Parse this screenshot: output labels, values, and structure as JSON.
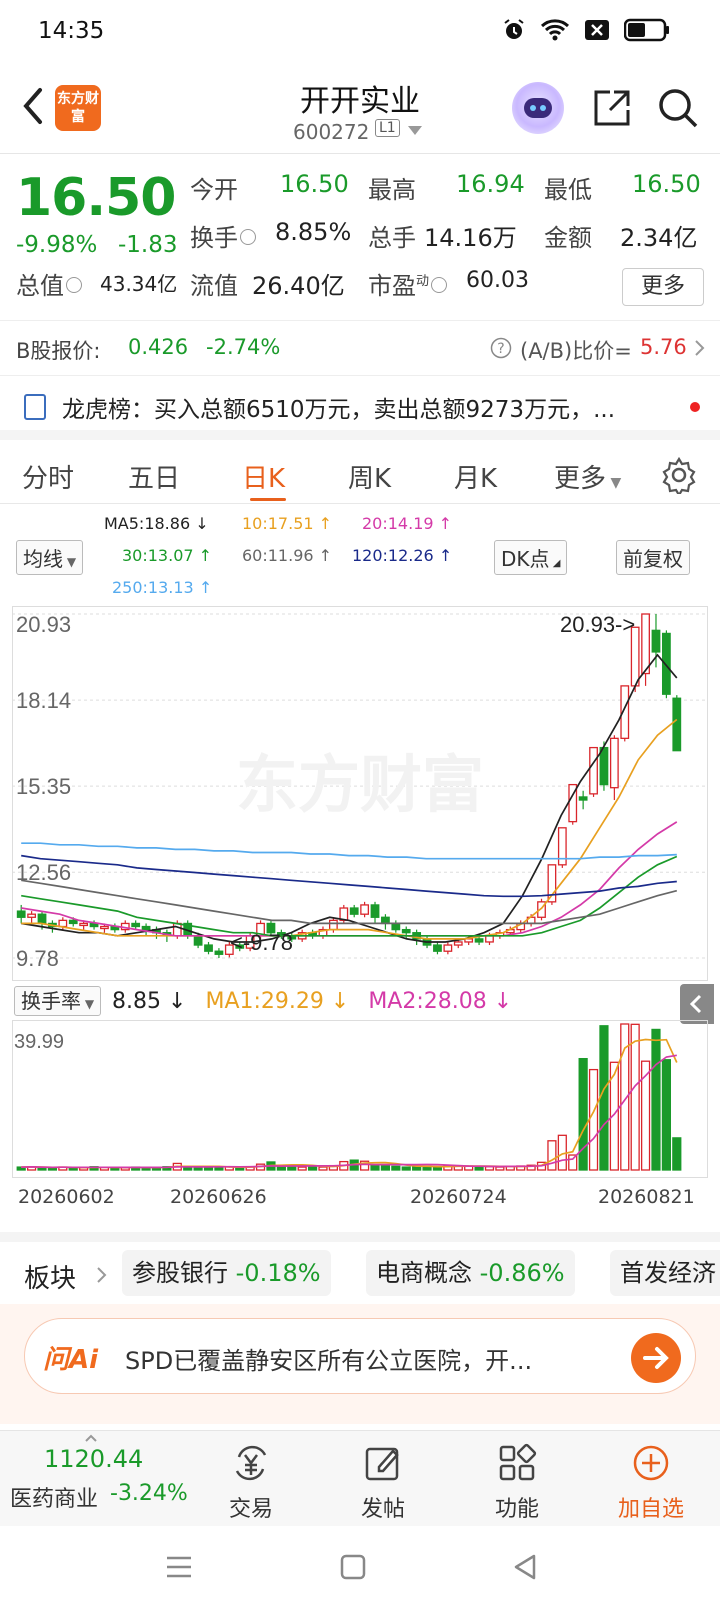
{
  "status_bar": {
    "time": "14:35"
  },
  "header": {
    "logo_text": "东方财富",
    "stock_name": "开开实业",
    "stock_code": "600272",
    "level_badge": "L1"
  },
  "quote": {
    "price": "16.50",
    "change_pct": "-9.98%",
    "change_amt": "-1.83",
    "open_label": "今开",
    "open_value": "16.50",
    "high_label": "最高",
    "high_value": "16.94",
    "low_label": "最低",
    "low_value": "16.50",
    "turnover_label": "换手",
    "turnover_value": "8.85%",
    "volume_label": "总手",
    "volume_value": "14.16万",
    "amount_label": "金额",
    "amount_value": "2.34亿",
    "mktcap_label": "总值",
    "mktcap_value": "43.34亿",
    "float_label": "流值",
    "float_value": "26.40亿",
    "pe_label": "市盈",
    "pe_sup": "动",
    "pe_value": "60.03",
    "more_label": "更多"
  },
  "b_share": {
    "label": "B股报价:",
    "price": "0.426",
    "change": "-2.74%",
    "ratio_label": "(A/B)比价=",
    "ratio_value": "5.76"
  },
  "dragon_tiger": {
    "text": "龙虎榜：买入总额6510万元，卖出总额9273万元，..."
  },
  "tabs": [
    "分时",
    "五日",
    "日K",
    "周K",
    "月K",
    "更多"
  ],
  "active_tab": "日K",
  "ma_legend": {
    "junxian_label": "均线",
    "ma5": "MA5:18.86",
    "ma10": "10:17.51",
    "ma20": "20:14.19",
    "ma30": "30:13.07",
    "ma60": "60:11.96",
    "ma120": "120:12.26",
    "ma250": "250:13.13",
    "dk_label": "DK点",
    "fuquan_label": "前复权",
    "colors": {
      "ma5": "#222222",
      "ma10": "#e8a020",
      "ma20": "#d43aa8",
      "ma30": "#1a9a2a",
      "ma60": "#666666",
      "ma120": "#1a2a8a",
      "ma250": "#55aaee"
    }
  },
  "watermark": "东方财富",
  "chart_data": [
    {
      "type": "candlestick",
      "y_ticks": [
        "20.93",
        "18.14",
        "15.35",
        "12.56",
        "9.78"
      ],
      "ylim": [
        9.78,
        20.93
      ],
      "high_marker": "20.93->",
      "low_marker": "<-9.78",
      "candles": [
        {
          "o": 11.3,
          "c": 11.1,
          "h": 11.5,
          "l": 10.9
        },
        {
          "o": 11.1,
          "c": 11.2,
          "h": 11.3,
          "l": 10.9
        },
        {
          "o": 11.2,
          "c": 10.9,
          "h": 11.3,
          "l": 10.7
        },
        {
          "o": 10.9,
          "c": 10.8,
          "h": 11.0,
          "l": 10.6
        },
        {
          "o": 10.8,
          "c": 11.0,
          "h": 11.1,
          "l": 10.7
        },
        {
          "o": 11.0,
          "c": 10.9,
          "h": 11.1,
          "l": 10.8
        },
        {
          "o": 10.9,
          "c": 10.9,
          "h": 11.0,
          "l": 10.7
        },
        {
          "o": 10.9,
          "c": 10.8,
          "h": 11.0,
          "l": 10.7
        },
        {
          "o": 10.8,
          "c": 10.8,
          "h": 10.9,
          "l": 10.6
        },
        {
          "o": 10.8,
          "c": 10.7,
          "h": 10.9,
          "l": 10.6
        },
        {
          "o": 10.7,
          "c": 10.9,
          "h": 11.0,
          "l": 10.6
        },
        {
          "o": 10.9,
          "c": 10.8,
          "h": 11.0,
          "l": 10.7
        },
        {
          "o": 10.8,
          "c": 10.7,
          "h": 10.9,
          "l": 10.5
        },
        {
          "o": 10.7,
          "c": 10.6,
          "h": 10.8,
          "l": 10.4
        },
        {
          "o": 10.6,
          "c": 10.5,
          "h": 10.7,
          "l": 10.3
        },
        {
          "o": 10.5,
          "c": 10.9,
          "h": 11.0,
          "l": 10.4
        },
        {
          "o": 10.9,
          "c": 10.5,
          "h": 11.0,
          "l": 10.4
        },
        {
          "o": 10.5,
          "c": 10.2,
          "h": 10.6,
          "l": 10.1
        },
        {
          "o": 10.2,
          "c": 10.0,
          "h": 10.3,
          "l": 9.9
        },
        {
          "o": 10.0,
          "c": 9.9,
          "h": 10.1,
          "l": 9.78
        },
        {
          "o": 9.9,
          "c": 10.2,
          "h": 10.3,
          "l": 9.8
        },
        {
          "o": 10.2,
          "c": 10.1,
          "h": 10.3,
          "l": 10.0
        },
        {
          "o": 10.1,
          "c": 10.5,
          "h": 10.6,
          "l": 10.0
        },
        {
          "o": 10.5,
          "c": 10.9,
          "h": 11.0,
          "l": 10.4
        },
        {
          "o": 10.9,
          "c": 10.6,
          "h": 11.0,
          "l": 10.5
        },
        {
          "o": 10.6,
          "c": 10.5,
          "h": 10.7,
          "l": 10.4
        },
        {
          "o": 10.5,
          "c": 10.4,
          "h": 10.6,
          "l": 10.3
        },
        {
          "o": 10.4,
          "c": 10.6,
          "h": 10.7,
          "l": 10.3
        },
        {
          "o": 10.6,
          "c": 10.5,
          "h": 10.7,
          "l": 10.4
        },
        {
          "o": 10.5,
          "c": 10.7,
          "h": 10.8,
          "l": 10.4
        },
        {
          "o": 10.7,
          "c": 11.0,
          "h": 11.1,
          "l": 10.6
        },
        {
          "o": 11.0,
          "c": 11.4,
          "h": 11.5,
          "l": 10.9
        },
        {
          "o": 11.4,
          "c": 11.2,
          "h": 11.5,
          "l": 11.1
        },
        {
          "o": 11.2,
          "c": 11.5,
          "h": 11.6,
          "l": 11.1
        },
        {
          "o": 11.5,
          "c": 11.1,
          "h": 11.6,
          "l": 10.9
        },
        {
          "o": 11.1,
          "c": 10.9,
          "h": 11.2,
          "l": 10.7
        },
        {
          "o": 10.9,
          "c": 10.7,
          "h": 11.0,
          "l": 10.6
        },
        {
          "o": 10.7,
          "c": 10.6,
          "h": 10.8,
          "l": 10.4
        },
        {
          "o": 10.6,
          "c": 10.4,
          "h": 10.7,
          "l": 10.2
        },
        {
          "o": 10.4,
          "c": 10.2,
          "h": 10.5,
          "l": 10.1
        },
        {
          "o": 10.2,
          "c": 10.0,
          "h": 10.3,
          "l": 9.9
        },
        {
          "o": 10.0,
          "c": 10.2,
          "h": 10.3,
          "l": 9.9
        },
        {
          "o": 10.2,
          "c": 10.3,
          "h": 10.4,
          "l": 10.1
        },
        {
          "o": 10.3,
          "c": 10.4,
          "h": 10.5,
          "l": 10.2
        },
        {
          "o": 10.4,
          "c": 10.3,
          "h": 10.5,
          "l": 10.2
        },
        {
          "o": 10.3,
          "c": 10.5,
          "h": 10.6,
          "l": 10.2
        },
        {
          "o": 10.5,
          "c": 10.6,
          "h": 10.7,
          "l": 10.4
        },
        {
          "o": 10.6,
          "c": 10.7,
          "h": 10.8,
          "l": 10.5
        },
        {
          "o": 10.7,
          "c": 10.9,
          "h": 11.0,
          "l": 10.6
        },
        {
          "o": 10.9,
          "c": 11.1,
          "h": 11.2,
          "l": 10.8
        },
        {
          "o": 11.1,
          "c": 11.6,
          "h": 11.7,
          "l": 11.0
        },
        {
          "o": 11.6,
          "c": 12.8,
          "h": 12.8,
          "l": 11.5
        },
        {
          "o": 12.8,
          "c": 14.0,
          "h": 14.0,
          "l": 12.7
        },
        {
          "o": 14.2,
          "c": 15.4,
          "h": 15.4,
          "l": 14.1
        },
        {
          "o": 15.0,
          "c": 14.9,
          "h": 15.2,
          "l": 14.6
        },
        {
          "o": 15.1,
          "c": 16.6,
          "h": 16.6,
          "l": 15.0
        },
        {
          "o": 16.6,
          "c": 15.4,
          "h": 16.8,
          "l": 15.2
        },
        {
          "o": 15.3,
          "c": 16.9,
          "h": 17.0,
          "l": 14.9
        },
        {
          "o": 16.9,
          "c": 18.6,
          "h": 18.6,
          "l": 16.8
        },
        {
          "o": 18.6,
          "c": 20.5,
          "h": 20.5,
          "l": 18.4
        },
        {
          "o": 19.0,
          "c": 20.93,
          "h": 20.93,
          "l": 18.6
        },
        {
          "o": 20.4,
          "c": 19.7,
          "h": 20.93,
          "l": 19.2
        },
        {
          "o": 20.3,
          "c": 18.33,
          "h": 20.4,
          "l": 18.2
        },
        {
          "o": 18.2,
          "c": 16.5,
          "h": 18.3,
          "l": 16.5
        }
      ],
      "ma_lines": {
        "ma5": [
          10.9,
          10.8,
          10.7,
          10.6,
          10.6,
          10.5,
          10.6,
          10.7,
          10.8,
          10.6,
          10.4,
          10.3,
          10.3,
          10.4,
          10.6,
          10.9,
          11.1,
          11.0,
          10.8,
          10.6,
          10.4,
          10.3,
          10.3,
          10.4,
          10.6,
          10.9,
          11.8,
          13.0,
          14.4,
          15.5,
          16.4,
          17.5,
          18.8,
          19.6,
          18.86
        ],
        "ma10": [
          10.9,
          10.9,
          10.8,
          10.7,
          10.6,
          10.5,
          10.5,
          10.5,
          10.5,
          10.5,
          10.5,
          10.5,
          10.5,
          10.5,
          10.5,
          10.6,
          10.7,
          10.7,
          10.7,
          10.6,
          10.5,
          10.4,
          10.4,
          10.4,
          10.5,
          10.6,
          10.9,
          11.4,
          12.2,
          13.0,
          14.0,
          15.0,
          16.2,
          17.0,
          17.51
        ],
        "ma20": [
          11.4,
          11.3,
          11.2,
          11.0,
          10.9,
          10.8,
          10.7,
          10.6,
          10.5,
          10.5,
          10.5,
          10.5,
          10.5,
          10.5,
          10.5,
          10.5,
          10.5,
          10.5,
          10.5,
          10.5,
          10.5,
          10.5,
          10.5,
          10.5,
          10.5,
          10.5,
          10.6,
          10.8,
          11.1,
          11.5,
          12.0,
          12.7,
          13.3,
          13.8,
          14.19
        ],
        "ma30": [
          11.8,
          11.7,
          11.6,
          11.5,
          11.4,
          11.3,
          11.1,
          11.0,
          10.9,
          10.8,
          10.7,
          10.6,
          10.6,
          10.5,
          10.5,
          10.5,
          10.5,
          10.5,
          10.5,
          10.5,
          10.5,
          10.5,
          10.5,
          10.5,
          10.5,
          10.5,
          10.5,
          10.6,
          10.8,
          11.0,
          11.4,
          11.9,
          12.4,
          12.8,
          13.07
        ],
        "ma60": [
          12.3,
          12.2,
          12.1,
          12.0,
          11.9,
          11.8,
          11.7,
          11.6,
          11.5,
          11.4,
          11.3,
          11.2,
          11.1,
          11.0,
          11.0,
          10.9,
          10.9,
          10.9,
          10.9,
          10.9,
          10.9,
          10.9,
          10.9,
          10.9,
          10.9,
          10.9,
          10.9,
          10.9,
          11.0,
          11.1,
          11.2,
          11.4,
          11.6,
          11.8,
          11.96
        ],
        "ma120": [
          13.1,
          13.0,
          12.95,
          12.9,
          12.85,
          12.8,
          12.7,
          12.65,
          12.6,
          12.55,
          12.5,
          12.45,
          12.4,
          12.35,
          12.3,
          12.25,
          12.2,
          12.15,
          12.1,
          12.05,
          12.0,
          11.95,
          11.9,
          11.85,
          11.8,
          11.78,
          11.78,
          11.8,
          11.85,
          11.9,
          11.95,
          12.05,
          12.1,
          12.2,
          12.26
        ],
        "ma250": [
          13.5,
          13.5,
          13.45,
          13.45,
          13.4,
          13.4,
          13.35,
          13.35,
          13.3,
          13.3,
          13.25,
          13.25,
          13.2,
          13.2,
          13.2,
          13.15,
          13.15,
          13.1,
          13.1,
          13.05,
          13.05,
          13.0,
          13.0,
          13.0,
          13.0,
          13.0,
          13.0,
          13.0,
          13.0,
          13.0,
          13.05,
          13.05,
          13.1,
          13.1,
          13.13
        ]
      }
    },
    {
      "type": "bar",
      "title": "换手率",
      "y_ticks": [
        "39.99"
      ],
      "ylim": [
        0,
        39.99
      ],
      "x_ticks": [
        "20260602",
        "20260626",
        "20260724",
        "20260821"
      ],
      "values": [
        0.8,
        0.9,
        0.7,
        0.6,
        0.8,
        0.7,
        0.6,
        0.9,
        0.7,
        0.7,
        0.6,
        0.8,
        0.7,
        0.7,
        0.9,
        1.8,
        0.9,
        0.7,
        0.8,
        0.8,
        0.9,
        0.7,
        0.8,
        1.6,
        2.2,
        1.3,
        1.1,
        0.8,
        0.9,
        0.8,
        1.2,
        2.3,
        2.7,
        2.4,
        1.4,
        1.3,
        1.0,
        0.8,
        0.9,
        1.0,
        0.9,
        1.1,
        1.2,
        1.1,
        1.0,
        0.9,
        0.8,
        1.0,
        1.1,
        1.3,
        2.1,
        8.0,
        9.5,
        4.1,
        30.5,
        27.5,
        39.5,
        29.5,
        39.99,
        39.9,
        29.8,
        38.5,
        30.2,
        8.8
      ],
      "ma1": "MA1:29.29",
      "ma2": "MA2:28.08",
      "turnover_value": "8.85"
    }
  ],
  "sectors": {
    "label": "板块",
    "items": [
      {
        "name": "参股银行",
        "change": "-0.18%"
      },
      {
        "name": "电商概念",
        "change": "-0.86%"
      },
      {
        "name": "首发经济",
        "change": ""
      }
    ]
  },
  "ai_bar": {
    "brand": "问Ai",
    "text": "SPD已覆盖静安区所有公立医院，开..."
  },
  "bottom_bar": {
    "index_value": "1120.44",
    "index_name": "医药商业",
    "index_change": "-3.24%",
    "trade_label": "交易",
    "post_label": "发帖",
    "func_label": "功能",
    "watch_label": "加自选"
  }
}
